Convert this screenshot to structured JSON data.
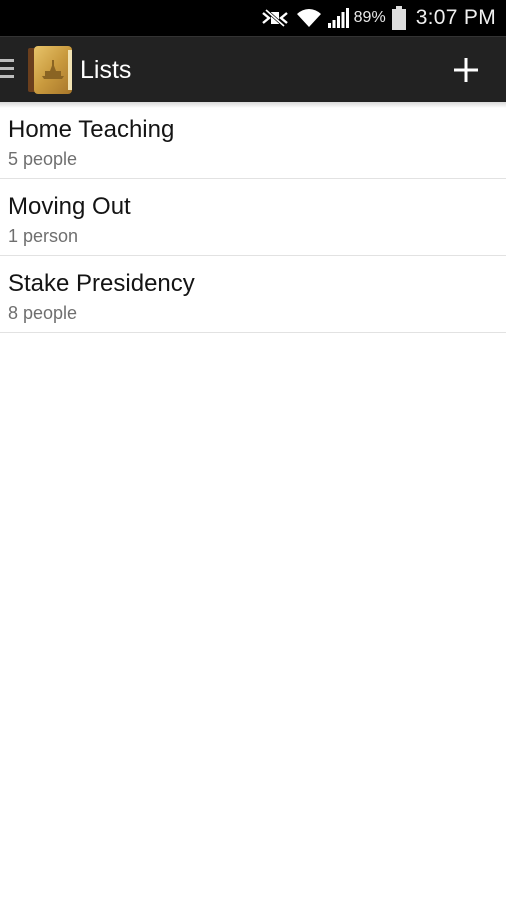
{
  "status_bar": {
    "battery_percent": "89%",
    "time": "3:07 PM",
    "icons": [
      "no-notifications-icon",
      "wifi-icon",
      "signal-icon",
      "battery-icon"
    ]
  },
  "action_bar": {
    "title": "Lists",
    "icons": [
      "drawer-menu-icon",
      "app-logo-icon",
      "add-icon"
    ]
  },
  "lists": [
    {
      "name": "Home Teaching",
      "count": "5 people"
    },
    {
      "name": "Moving Out",
      "count": "1 person"
    },
    {
      "name": "Stake Presidency",
      "count": "8 people"
    }
  ],
  "colors": {
    "status_bar_bg": "#000000",
    "action_bar_bg": "#222222",
    "divider": "#e2e2e2",
    "subtitle_text": "#6f6f6f"
  }
}
